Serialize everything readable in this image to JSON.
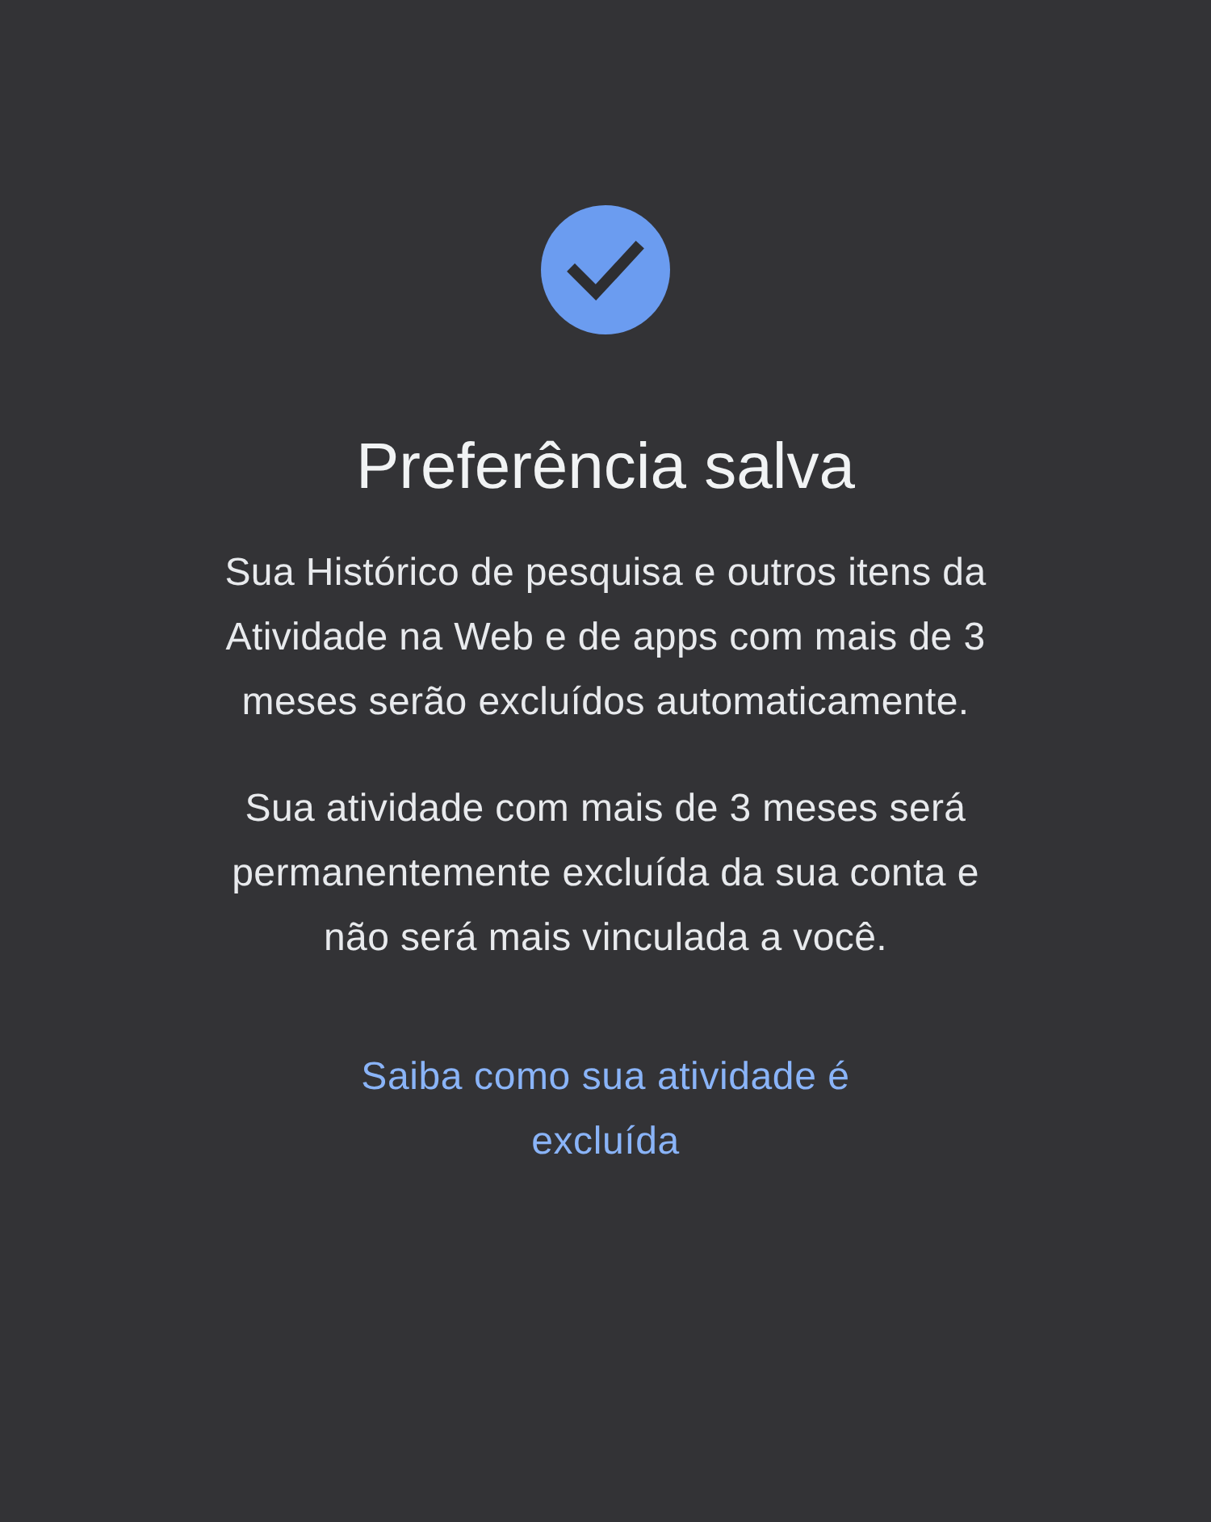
{
  "title": "Preferência salva",
  "paragraphs": [
    "Sua Histórico de pesquisa e outros itens da Atividade na Web e de apps com mais de 3 meses serão excluídos automaticamente.",
    "Sua atividade com mais de 3 meses será permanentemente excluída da sua conta e não será mais vinculada a você."
  ],
  "link": "Saiba como sua atividade é excluída"
}
